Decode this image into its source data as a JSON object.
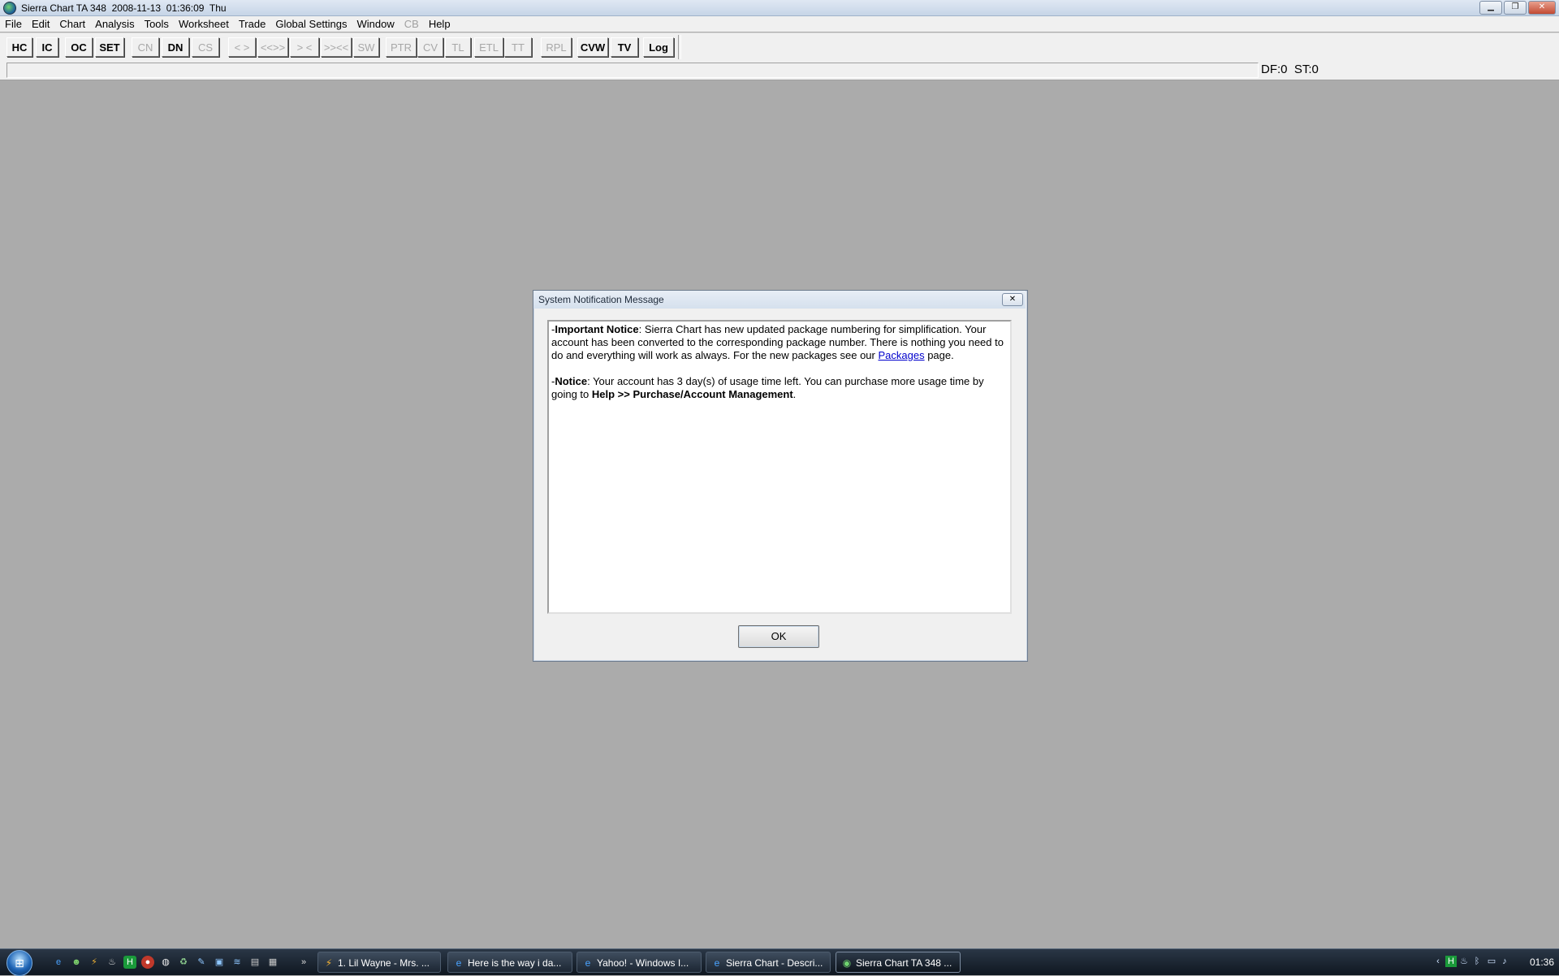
{
  "window": {
    "title": "Sierra Chart TA 348  2008-11-13  01:36:09  Thu",
    "controls": [
      "minimize",
      "restore",
      "close"
    ]
  },
  "menubar": {
    "items": [
      "File",
      "Edit",
      "Chart",
      "Analysis",
      "Tools",
      "Worksheet",
      "Trade",
      "Global Settings",
      "Window",
      "CB",
      "Help"
    ]
  },
  "toolbar": {
    "buttons": [
      {
        "label": "HC",
        "enabled": true
      },
      {
        "label": "IC",
        "enabled": true
      },
      {
        "label": "OC",
        "enabled": true
      },
      {
        "label": "SET",
        "enabled": true
      },
      {
        "label": "CN",
        "enabled": false
      },
      {
        "label": "DN",
        "enabled": true
      },
      {
        "label": "CS",
        "enabled": false
      },
      {
        "label": "< >",
        "enabled": false
      },
      {
        "label": "<<>>",
        "enabled": false
      },
      {
        "label": "> <",
        "enabled": false
      },
      {
        "label": ">><<",
        "enabled": false
      },
      {
        "label": "SW",
        "enabled": false
      },
      {
        "label": "PTR",
        "enabled": false
      },
      {
        "label": "CV",
        "enabled": false
      },
      {
        "label": "TL",
        "enabled": false
      },
      {
        "label": "ETL",
        "enabled": false
      },
      {
        "label": "TT",
        "enabled": false
      },
      {
        "label": "RPL",
        "enabled": false
      },
      {
        "label": "CVW",
        "enabled": true
      },
      {
        "label": "TV",
        "enabled": true
      },
      {
        "label": "Log",
        "enabled": true
      }
    ]
  },
  "status": {
    "df_st": "DF:0  ST:0"
  },
  "dialog": {
    "title": "System Notification Message",
    "close_label": "✕",
    "notice1": {
      "prefix": "-",
      "bold": "Important Notice",
      "text": ": Sierra Chart has new updated package numbering for simplification. Your account has been converted to the corresponding package number. There is nothing you need to do and everything will work as always. For the new packages see our ",
      "link": "Packages",
      "suffix": " page."
    },
    "notice2": {
      "prefix": "-",
      "bold": "Notice",
      "text": ": Your account has 3 day(s) of usage time left. You can purchase more usage time by going to ",
      "bold2": "Help >> Purchase/Account Management",
      "suffix": "."
    },
    "ok_label": "OK"
  },
  "taskbar": {
    "start_icon": "windows-orb-icon",
    "tasks": [
      {
        "label": "1. Lil Wayne - Mrs. ...",
        "icon": "winamp-icon"
      },
      {
        "label": "Here is the way i da...",
        "icon": "ie-icon"
      },
      {
        "label": "Yahoo! - Windows I...",
        "icon": "ie-icon"
      },
      {
        "label": "Sierra Chart - Descri...",
        "icon": "ie-icon"
      },
      {
        "label": "Sierra Chart TA 348  ...",
        "icon": "sierra-chart-icon",
        "active": true
      }
    ],
    "clock": "01:36"
  }
}
